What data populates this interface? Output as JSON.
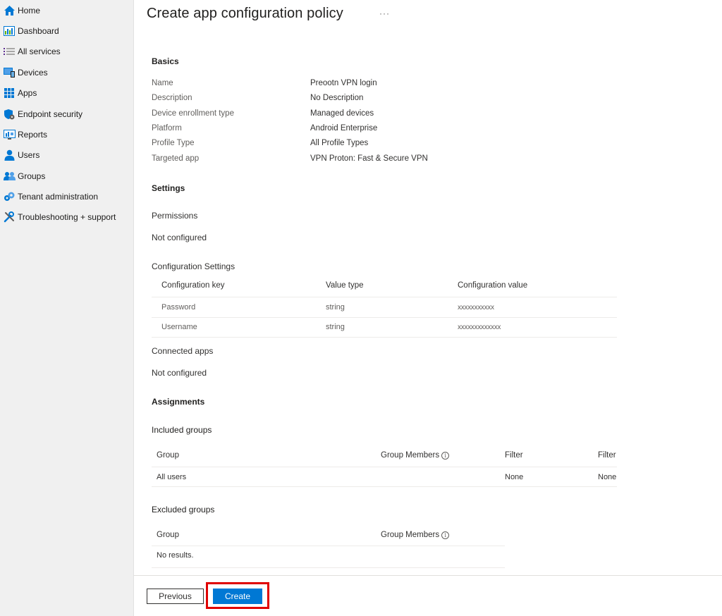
{
  "sidebar": {
    "items": [
      {
        "label": "Home",
        "icon": "home-icon"
      },
      {
        "label": "Dashboard",
        "icon": "dashboard-icon"
      },
      {
        "label": "All services",
        "icon": "list-icon"
      },
      {
        "label": "Devices",
        "icon": "devices-icon"
      },
      {
        "label": "Apps",
        "icon": "apps-grid-icon"
      },
      {
        "label": "Endpoint security",
        "icon": "shield-icon"
      },
      {
        "label": "Reports",
        "icon": "reports-icon"
      },
      {
        "label": "Users",
        "icon": "user-icon"
      },
      {
        "label": "Groups",
        "icon": "groups-icon"
      },
      {
        "label": "Tenant administration",
        "icon": "gear-icon"
      },
      {
        "label": "Troubleshooting + support",
        "icon": "wrench-icon"
      }
    ]
  },
  "page": {
    "title": "Create app configuration policy",
    "more": "···"
  },
  "basics": {
    "heading": "Basics",
    "rows": [
      {
        "label": "Name",
        "value": "Preootn VPN login"
      },
      {
        "label": "Description",
        "value": "No Description"
      },
      {
        "label": "Device enrollment type",
        "value": "Managed devices"
      },
      {
        "label": "Platform",
        "value": "Android Enterprise"
      },
      {
        "label": "Profile Type",
        "value": "All Profile Types"
      },
      {
        "label": "Targeted app",
        "value": "VPN Proton: Fast & Secure VPN"
      }
    ]
  },
  "settings": {
    "heading": "Settings",
    "permissions_label": "Permissions",
    "permissions_value": "Not configured",
    "config_label": "Configuration Settings",
    "columns": [
      "Configuration key",
      "Value type",
      "Configuration value"
    ],
    "rows": [
      {
        "key": "Password",
        "type": "string",
        "value": "xxxxxxxxxxx"
      },
      {
        "key": "Username",
        "type": "string",
        "value": "xxxxxxxxxxxxx"
      }
    ],
    "connected_label": "Connected apps",
    "connected_value": "Not configured"
  },
  "assignments": {
    "heading": "Assignments",
    "included": {
      "heading": "Included groups",
      "columns": [
        "Group",
        "Group Members",
        "Filter",
        "Filter"
      ],
      "rows": [
        {
          "group": "All users",
          "members": "",
          "filter": "None",
          "filter2": "None"
        }
      ]
    },
    "excluded": {
      "heading": "Excluded groups",
      "columns": [
        "Group",
        "Group Members"
      ],
      "empty": "No results."
    },
    "info_glyph": "i"
  },
  "footer": {
    "previous": "Previous",
    "create": "Create"
  },
  "colors": {
    "primary": "#0078d4",
    "highlight": "#e00000"
  }
}
